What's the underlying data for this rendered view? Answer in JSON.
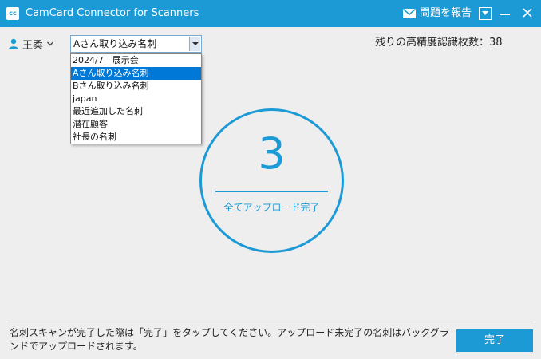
{
  "window": {
    "logo_text": "cc",
    "title": "CamCard Connector for Scanners",
    "report_label": "問題を報告",
    "accent_color": "#1c9ad6",
    "icons": [
      "mail-icon",
      "dropdown-box-icon",
      "minimize-icon",
      "close-icon"
    ]
  },
  "user": {
    "name": "王柔",
    "icon": "user-icon"
  },
  "group_select": {
    "selected": "Aさん取り込み名刺",
    "options": [
      "2024/7　展示会",
      "Aさん取り込み名刺",
      "Bさん取り込み名刺",
      "japan",
      "最近追加した名刺",
      "潜在顧客",
      "社長の名刺"
    ],
    "highlighted_index": 1
  },
  "remaining_label": "残りの高精度認識枚数：38",
  "progress": {
    "count": "3",
    "status": "全てアップロード完了"
  },
  "footer": {
    "note": "名刺スキャンが完了した際は「完了」をタップしてください。アップロード未完了の名刺はバックグランドでアップロードされます。",
    "done_label": "完了"
  }
}
